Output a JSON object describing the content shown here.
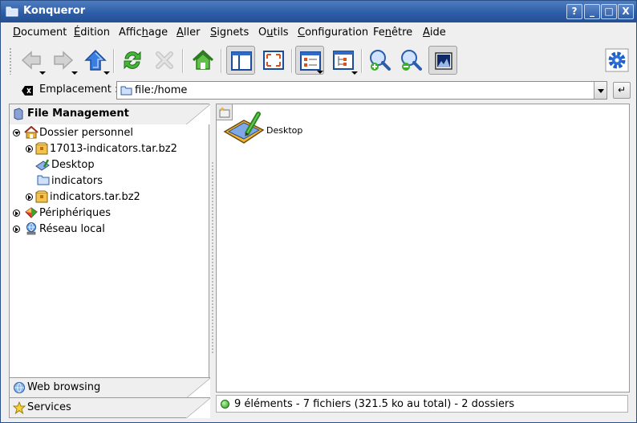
{
  "window": {
    "title": "Konqueror",
    "buttons": [
      "?",
      "_",
      "□",
      "X"
    ]
  },
  "menu": [
    {
      "label": "Document",
      "mnemonic": "D"
    },
    {
      "label": "Édition",
      "mnemonic": "É"
    },
    {
      "label": "Affichage",
      "mnemonic": "h"
    },
    {
      "label": "Aller",
      "mnemonic": "A"
    },
    {
      "label": "Signets",
      "mnemonic": "S"
    },
    {
      "label": "Outils",
      "mnemonic": "u"
    },
    {
      "label": "Configuration",
      "mnemonic": "C"
    },
    {
      "label": "Fenêtre",
      "mnemonic": "n"
    },
    {
      "label": "Aide",
      "mnemonic": "A"
    }
  ],
  "toolbar": {
    "tools": [
      "back-icon",
      "forward-icon",
      "up-icon",
      "reload-icon",
      "stop-icon",
      "home-icon",
      "split-view-icon",
      "fullscreen-icon",
      "view-icon-mode",
      "view-tree-mode",
      "zoom-in-icon",
      "zoom-out-icon",
      "preview-icon",
      "konqueror-gear-icon"
    ]
  },
  "location": {
    "label": "Emplacement :",
    "value": "file:/home"
  },
  "sidepanel": {
    "active_tab": "File Management",
    "tree": [
      {
        "label": "Dossier personnel",
        "level": 0,
        "expander": "open",
        "icon": "home-folder-icon"
      },
      {
        "label": "17013-indicators.tar.bz2",
        "level": 1,
        "expander": "closed",
        "icon": "archive-icon"
      },
      {
        "label": "Desktop",
        "level": 1,
        "expander": "none",
        "icon": "desktop-icon"
      },
      {
        "label": "indicators",
        "level": 1,
        "expander": "none",
        "icon": "folder-icon"
      },
      {
        "label": "indicators.tar.bz2",
        "level": 1,
        "expander": "closed",
        "icon": "archive-icon"
      },
      {
        "label": "Périphériques",
        "level": 0,
        "expander": "closed",
        "icon": "devices-icon"
      },
      {
        "label": "Réseau local",
        "level": 0,
        "expander": "closed",
        "icon": "network-icon"
      }
    ],
    "bottom_tabs": [
      "Web browsing",
      "Services"
    ]
  },
  "fileview": {
    "items": [
      {
        "label": "Desktop",
        "icon": "desktop-icon"
      }
    ]
  },
  "status": {
    "text": "9 éléments - 7 fichiers (321.5 ko au total) - 2 dossiers"
  }
}
